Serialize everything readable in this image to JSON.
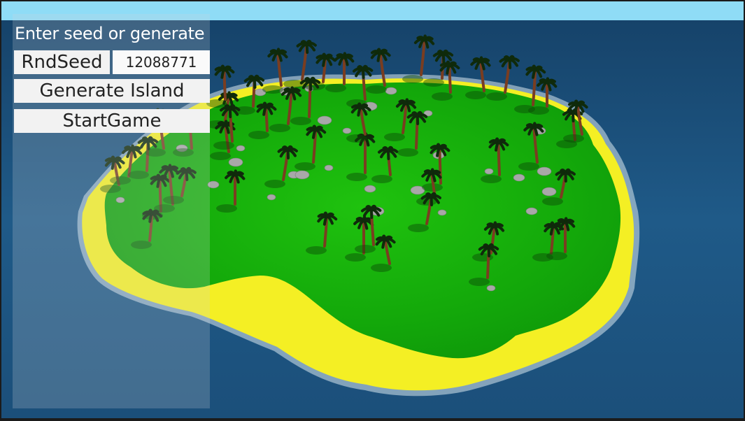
{
  "ui": {
    "panel_title": "Enter seed or generate",
    "rnd_seed_label": "RndSeed",
    "seed_value": "12088771",
    "generate_label": "Generate Island",
    "start_label": "StartGame"
  },
  "colors": {
    "sky": "#8fdcf6",
    "ocean": "#1f5b88",
    "sand": "#f4ef24",
    "grass": "#18b80c",
    "rock": "#a8a8a8",
    "palm_trunk": "#7a3d20",
    "palm_leaf": "#0f2a0b"
  }
}
